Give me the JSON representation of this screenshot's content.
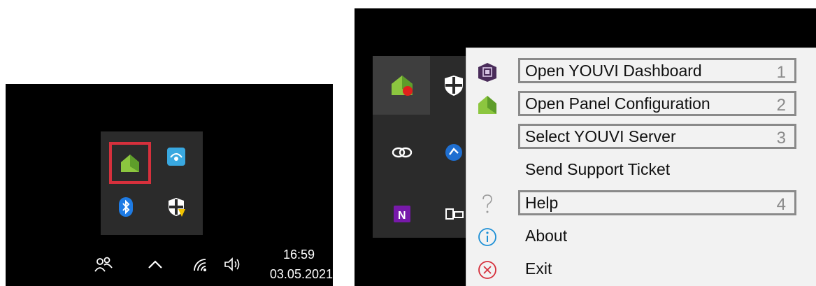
{
  "left": {
    "clock": {
      "time": "16:59",
      "date": "03.05.2021"
    }
  },
  "menu": {
    "items": [
      {
        "label": "Open YOUVI Dashboard",
        "number": "1",
        "icon": "youvi-dashboard-icon",
        "boxed": true
      },
      {
        "label": "Open Panel Configuration",
        "number": "2",
        "icon": "youvi-house-icon",
        "boxed": true
      },
      {
        "label": "Select YOUVI Server",
        "number": "3",
        "icon": "",
        "boxed": true
      },
      {
        "label": "Send Support Ticket",
        "number": "",
        "icon": "",
        "boxed": false
      },
      {
        "label": "Help",
        "number": "4",
        "icon": "question-icon",
        "boxed": true
      },
      {
        "label": "About",
        "number": "",
        "icon": "info-icon",
        "boxed": false
      },
      {
        "label": "Exit",
        "number": "",
        "icon": "exit-icon",
        "boxed": false
      }
    ]
  },
  "colors": {
    "highlight_red": "#d6303c",
    "youvi_green": "#8cc63f",
    "annotation_gray": "#8a8a8a",
    "taskbar": "#000000",
    "menu_bg": "#f2f2f2"
  }
}
